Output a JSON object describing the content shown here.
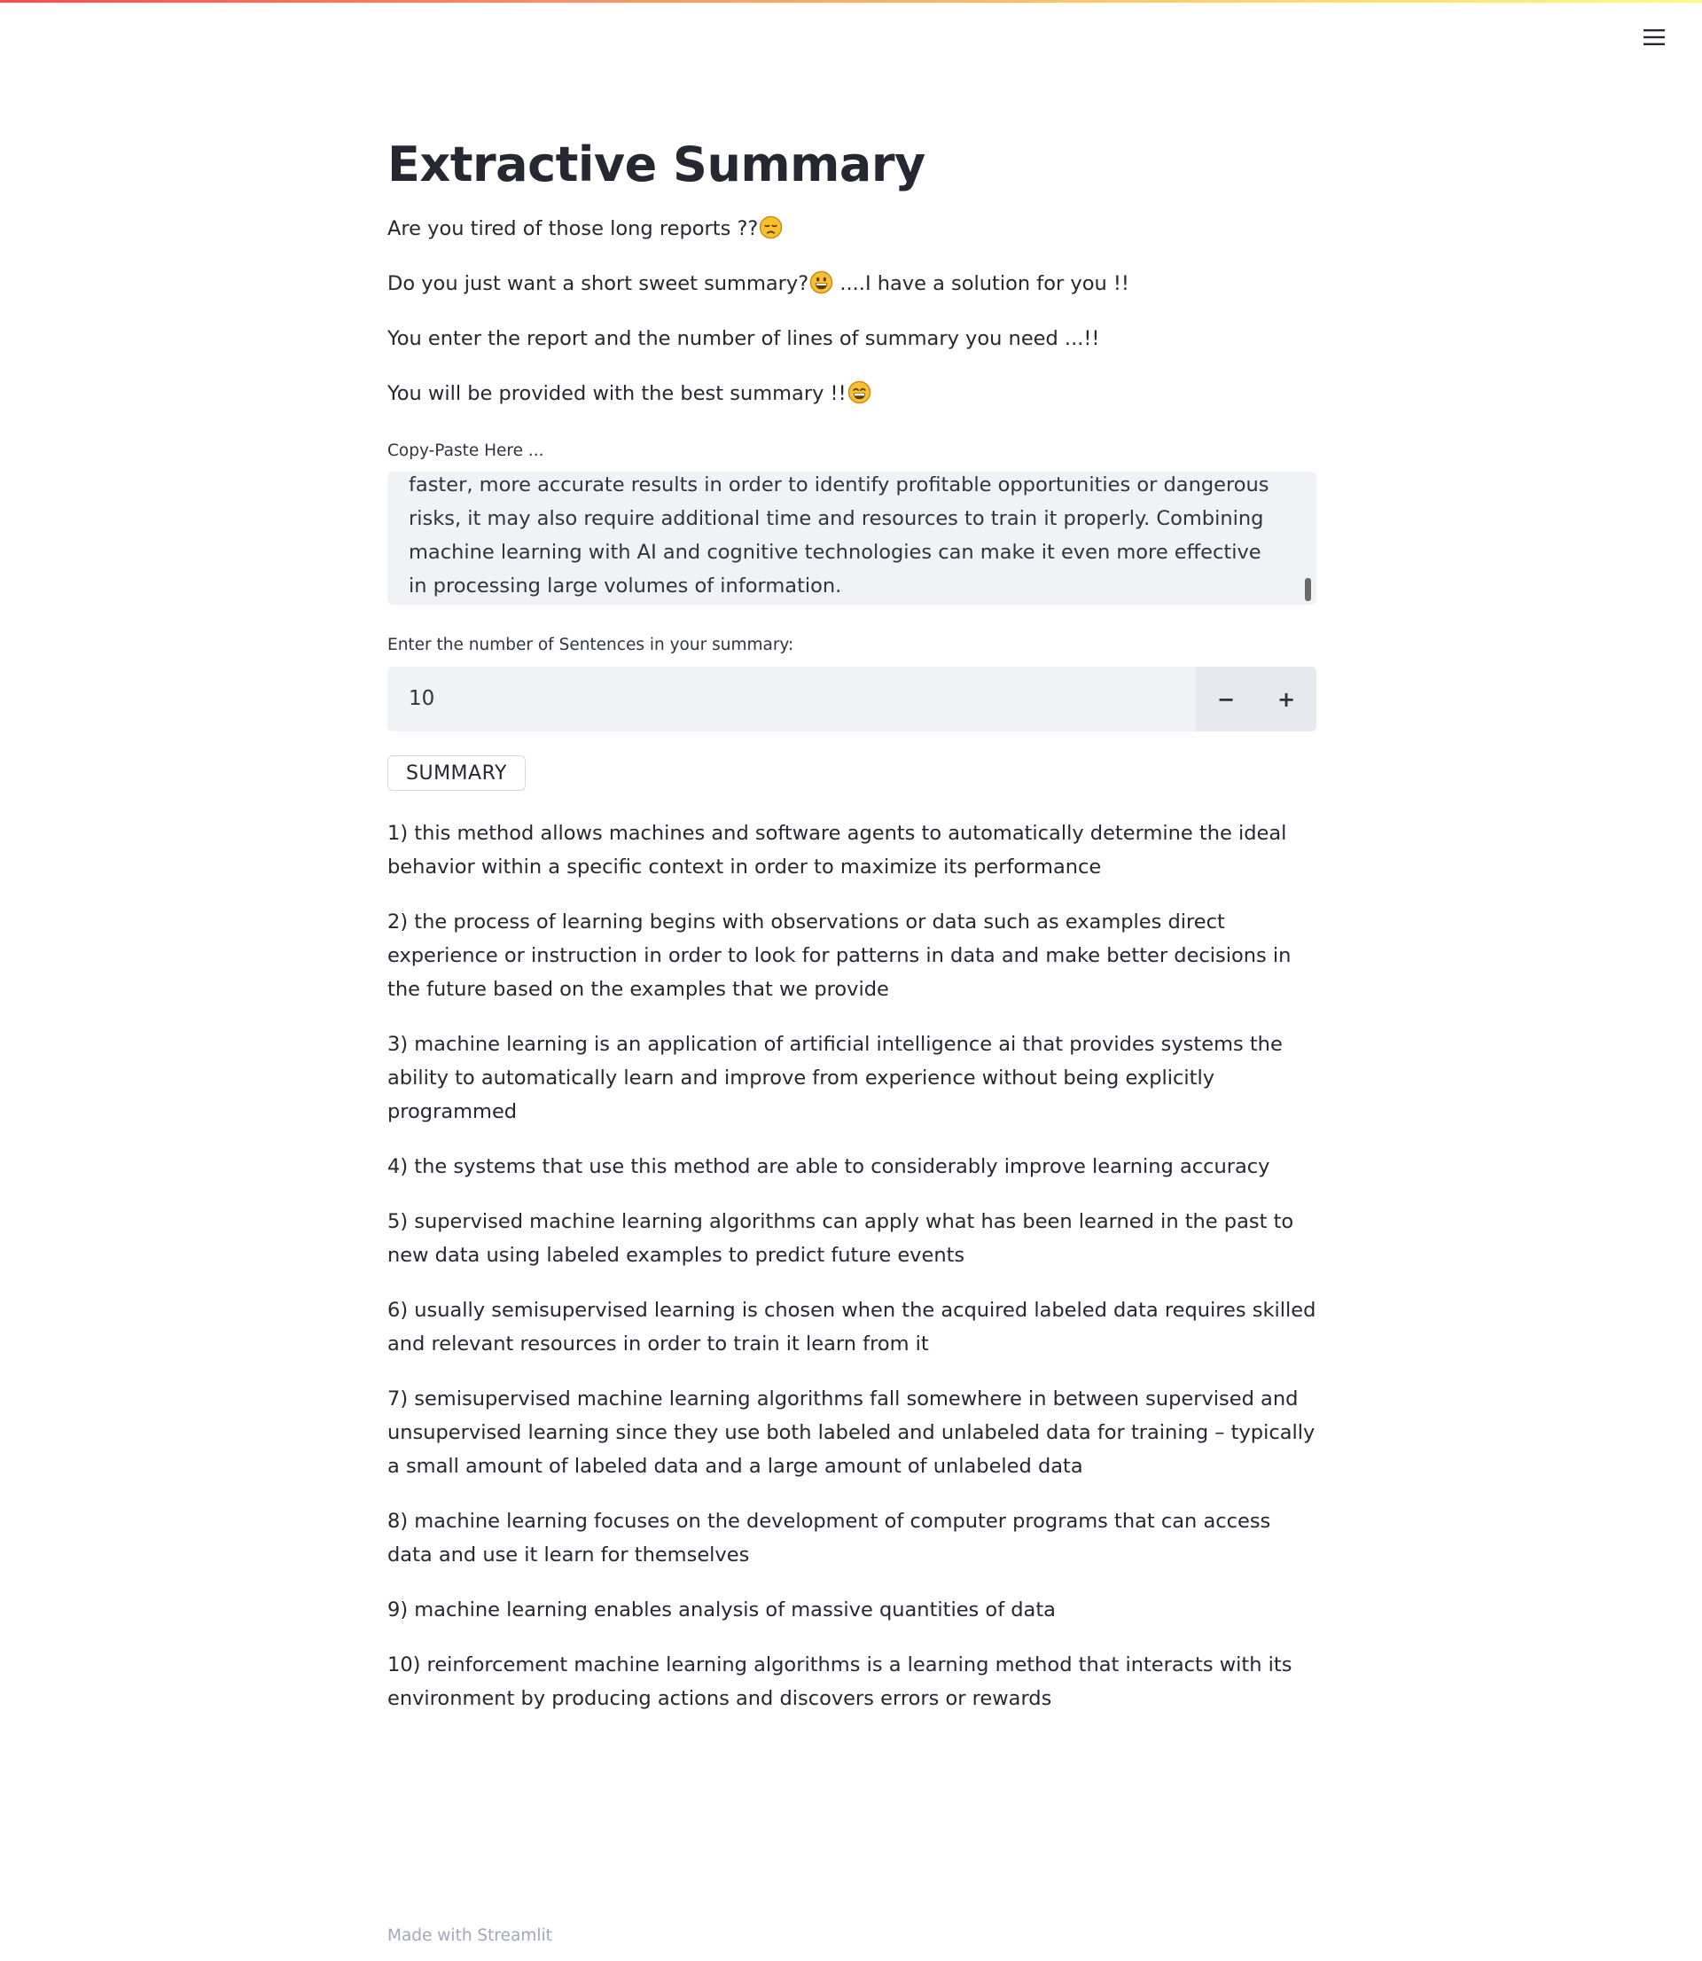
{
  "header": {
    "menu_icon": "hamburger-menu-icon"
  },
  "page": {
    "title": "Extractive Summary",
    "intro": [
      {
        "text": "Are you tired of those long reports ??",
        "emoji": "disappointed-face-icon",
        "suffix": ""
      },
      {
        "text": "Do you just want a short sweet summary?",
        "emoji": "grinning-face-icon",
        "suffix": " ....I have a solution for you !!"
      },
      {
        "text": "You enter the report and the number of lines of summary you need ...!!",
        "emoji": "",
        "suffix": ""
      },
      {
        "text": "You will be provided with the best summary !!",
        "emoji": "beaming-face-icon",
        "suffix": ""
      }
    ]
  },
  "text_input": {
    "label": "Copy-Paste Here ...",
    "visible_value": "faster, more accurate results in order to identify profitable opportunities or dangerous risks, it may also require additional time and resources to train it properly. Combining machine learning with AI and cognitive technologies can make it even more effective in processing large volumes of information."
  },
  "number_input": {
    "label": "Enter the number of Sentences in your summary:",
    "value": "10",
    "decrement_label": "−",
    "increment_label": "+"
  },
  "button": {
    "label": "SUMMARY"
  },
  "summary": {
    "items": [
      "1) this method allows machines and software agents to automatically determine the ideal behavior within a specific context in order to maximize its performance",
      "2) the process of learning begins with observations or data such as examples direct experience or instruction in order to look for patterns in data and make better decisions in the future based on the examples that we provide",
      "3) machine learning is an application of artificial intelligence ai that provides systems the ability to automatically learn and improve from experience without being explicitly programmed",
      "4) the systems that use this method are able to considerably improve learning accuracy",
      "5) supervised machine learning algorithms can apply what has been learned in the past to new data using labeled examples to predict future events",
      "6) usually semisupervised learning is chosen when the acquired labeled data requires skilled and relevant resources in order to train it learn from it",
      "7) semisupervised machine learning algorithms fall somewhere in between supervised and unsupervised learning since they use both labeled and unlabeled data for training – typically a small amount of labeled data and a large amount of unlabeled data",
      "8) machine learning focuses on the development of computer programs that can access data and use it learn for themselves",
      "9) machine learning enables analysis of massive quantities of data",
      "10) reinforcement machine learning algorithms is a learning method that interacts with its environment by producing actions and discovers errors or rewards"
    ]
  },
  "footer": {
    "text": "Made with Streamlit"
  },
  "colors": {
    "accent": "#ff4b4b",
    "input_background": "#f0f2f6",
    "text": "#262730",
    "footer_text": "#a3a8b8"
  }
}
